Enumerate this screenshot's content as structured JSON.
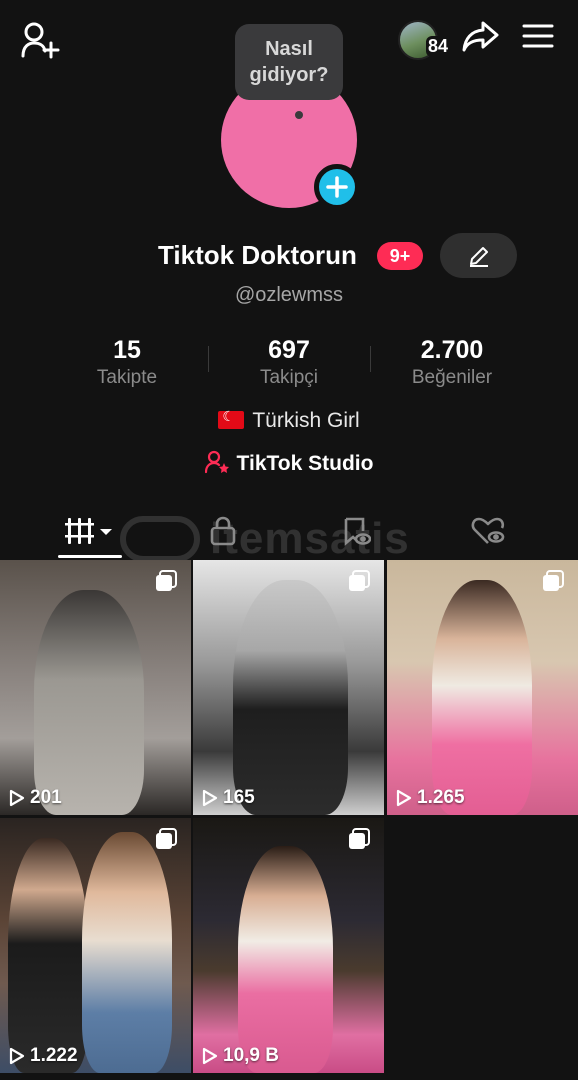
{
  "header": {
    "story_count": "84"
  },
  "profile": {
    "bubble_text": "Nasıl gidiyor?",
    "display_name": "Tiktok Doktorun",
    "notif_badge": "9+",
    "username": "@ozlewmss"
  },
  "stats": [
    {
      "value": "15",
      "label": "Takipte"
    },
    {
      "value": "697",
      "label": "Takipçi"
    },
    {
      "value": "2.700",
      "label": "Beğeniler"
    }
  ],
  "bio": {
    "text": "Türkish Girl"
  },
  "studio": {
    "label": "TikTok Studio"
  },
  "watermark": "itemsatis",
  "videos": [
    {
      "views": "201"
    },
    {
      "views": "165"
    },
    {
      "views": "1.265"
    },
    {
      "views": "1.222"
    },
    {
      "views": "10,9 B"
    }
  ],
  "colors": {
    "background": "#121212",
    "avatar": "#f06fa7",
    "accent_blue": "#20bfe9",
    "accent_red": "#fe2c55"
  }
}
